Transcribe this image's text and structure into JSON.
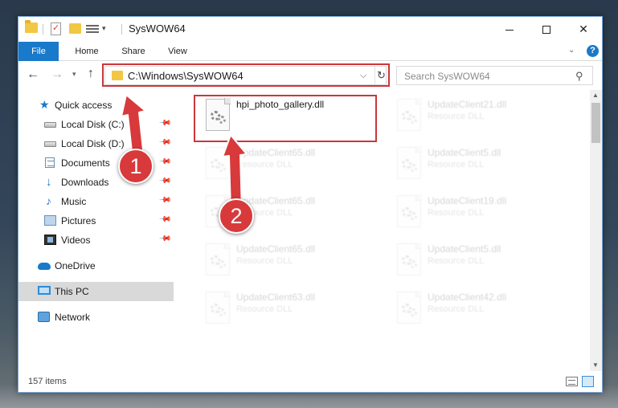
{
  "window": {
    "title": "SysWOW64",
    "controls": {
      "minimize": "",
      "maximize": "",
      "close": "✕"
    }
  },
  "quick_access_toolbar": {
    "dropdown": "▾"
  },
  "ribbon": {
    "tabs": [
      {
        "label": "File",
        "active": true
      },
      {
        "label": "Home"
      },
      {
        "label": "Share"
      },
      {
        "label": "View"
      }
    ],
    "collapse_icon": "chevron-down-icon",
    "help": "?"
  },
  "navigation": {
    "back": "←",
    "forward": "→",
    "recent": "▾",
    "up": "↑"
  },
  "address_bar": {
    "path": "C:\\Windows\\SysWOW64",
    "dropdown": "⌵",
    "refresh": "↻"
  },
  "search": {
    "placeholder": "Search SysWOW64",
    "icon": "⚲"
  },
  "sidebar": {
    "items": [
      {
        "label": "Quick access",
        "icon": "star-icon",
        "glyph": "★"
      },
      {
        "label": "Local Disk (C:)",
        "icon": "drive-icon",
        "pinned": true
      },
      {
        "label": "Local Disk (D:)",
        "icon": "drive-icon",
        "pinned": true
      },
      {
        "label": "Documents",
        "icon": "documents-icon",
        "pinned": true
      },
      {
        "label": "Downloads",
        "icon": "download-icon",
        "glyph": "↓",
        "pinned": true
      },
      {
        "label": "Music",
        "icon": "music-icon",
        "glyph": "♪",
        "pinned": true
      },
      {
        "label": "Pictures",
        "icon": "pictures-icon",
        "pinned": true
      },
      {
        "label": "Videos",
        "icon": "videos-icon",
        "pinned": true
      },
      {
        "label": "OneDrive",
        "icon": "cloud-icon"
      },
      {
        "label": "This PC",
        "icon": "computer-icon",
        "selected": true
      },
      {
        "label": "Network",
        "icon": "network-icon"
      }
    ],
    "pin_glyph": "📌"
  },
  "files": [
    {
      "name": "hpi_photo_gallery.dll",
      "type": "",
      "highlighted": true
    },
    {
      "name": "UpdateClient21.dll",
      "type": "Resource DLL"
    },
    {
      "name": "UpdateClient65.dll",
      "type": "Resource DLL"
    },
    {
      "name": "UpdateClient5.dll",
      "type": "Resource DLL"
    },
    {
      "name": "UpdateClient65.dll",
      "type": "Resource DLL"
    },
    {
      "name": "UpdateClient19.dll",
      "type": "Resource DLL"
    },
    {
      "name": "UpdateClient65.dll",
      "type": "Resource DLL"
    },
    {
      "name": "UpdateClient5.dll",
      "type": "Resource DLL"
    },
    {
      "name": "UpdateClient63.dll",
      "type": "Resource DLL"
    },
    {
      "name": "UpdateClient42.dll",
      "type": "Resource DLL"
    }
  ],
  "scrollbar": {
    "up": "▲",
    "down": "▼"
  },
  "status": {
    "item_count": "157 items"
  },
  "annotations": {
    "step1": "1",
    "step2": "2",
    "color": "#d8393b"
  }
}
